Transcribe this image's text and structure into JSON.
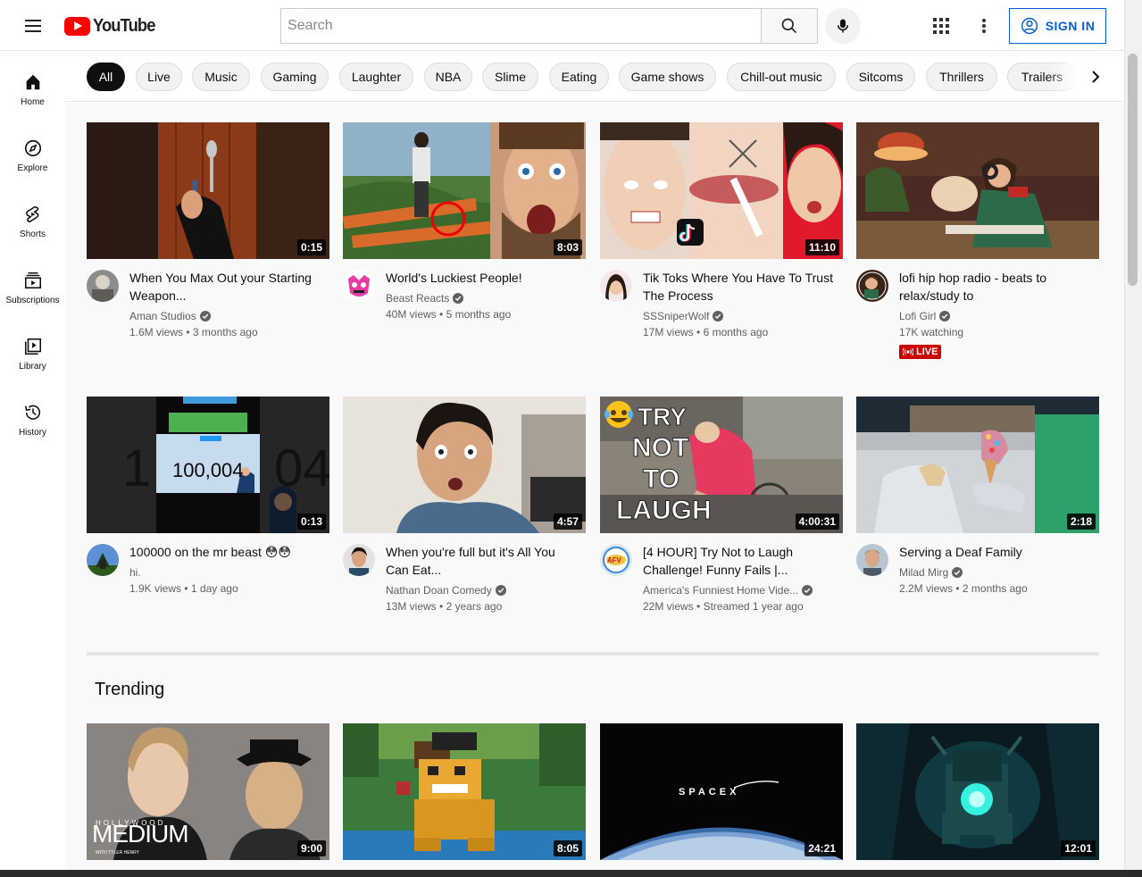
{
  "header": {
    "logo_text": "YouTube",
    "search_placeholder": "Search",
    "sign_in_label": "SIGN IN"
  },
  "sidebar": {
    "items": [
      {
        "label": "Home",
        "icon": "home-icon"
      },
      {
        "label": "Explore",
        "icon": "compass-icon"
      },
      {
        "label": "Shorts",
        "icon": "shorts-icon"
      },
      {
        "label": "Subscriptions",
        "icon": "subscriptions-icon"
      },
      {
        "label": "Library",
        "icon": "library-icon"
      },
      {
        "label": "History",
        "icon": "history-icon"
      }
    ]
  },
  "chips": [
    "All",
    "Live",
    "Music",
    "Gaming",
    "Laughter",
    "NBA",
    "Slime",
    "Eating",
    "Game shows",
    "Chill-out music",
    "Sitcoms",
    "Thrillers",
    "Trailers"
  ],
  "videos": [
    {
      "title": "When You Max Out your Starting Weapon...",
      "channel": "Aman Studios",
      "verified": true,
      "views": "1.6M views",
      "age": "3 months ago",
      "duration": "0:15"
    },
    {
      "title": "World's Luckiest People!",
      "channel": "Beast Reacts",
      "verified": true,
      "views": "40M views",
      "age": "5 months ago",
      "duration": "8:03"
    },
    {
      "title": "Tik Toks Where You Have To Trust The Process",
      "channel": "SSSniperWolf",
      "verified": true,
      "views": "17M views",
      "age": "6 months ago",
      "duration": "11:10"
    },
    {
      "title": "lofi hip hop radio - beats to relax/study to",
      "channel": "Lofi Girl",
      "verified": true,
      "watching": "17K watching",
      "live_label": "LIVE"
    },
    {
      "title": "100000 on the mr beast 😳😳",
      "channel": "hi.",
      "verified": false,
      "views": "1.9K views",
      "age": "1 day ago",
      "duration": "0:13",
      "thumb_text": "100,004"
    },
    {
      "title": "When you're full but it's All You Can Eat...",
      "channel": "Nathan Doan Comedy",
      "verified": true,
      "views": "13M views",
      "age": "2 years ago",
      "duration": "4:57"
    },
    {
      "title": "[4 HOUR] Try Not to Laugh Challenge! Funny Fails |...",
      "channel": "America's Funniest Home Vide...",
      "verified": true,
      "views": "22M views",
      "age": "Streamed 1 year ago",
      "duration": "4:00:31"
    },
    {
      "title": "Serving a Deaf Family",
      "channel": "Milad Mirg",
      "verified": true,
      "views": "2.2M views",
      "age": "2 months ago",
      "duration": "2:18"
    }
  ],
  "trending": {
    "title": "Trending",
    "videos": [
      {
        "duration": "9:00",
        "thumb_text": "MEDIUM"
      },
      {
        "duration": "8:05"
      },
      {
        "duration": "24:21",
        "thumb_text": "SPACEX"
      },
      {
        "duration": "12:01"
      }
    ]
  },
  "colors": {
    "brand_red": "#ff0000",
    "link_blue": "#065fd4",
    "live_red": "#cc0000"
  }
}
